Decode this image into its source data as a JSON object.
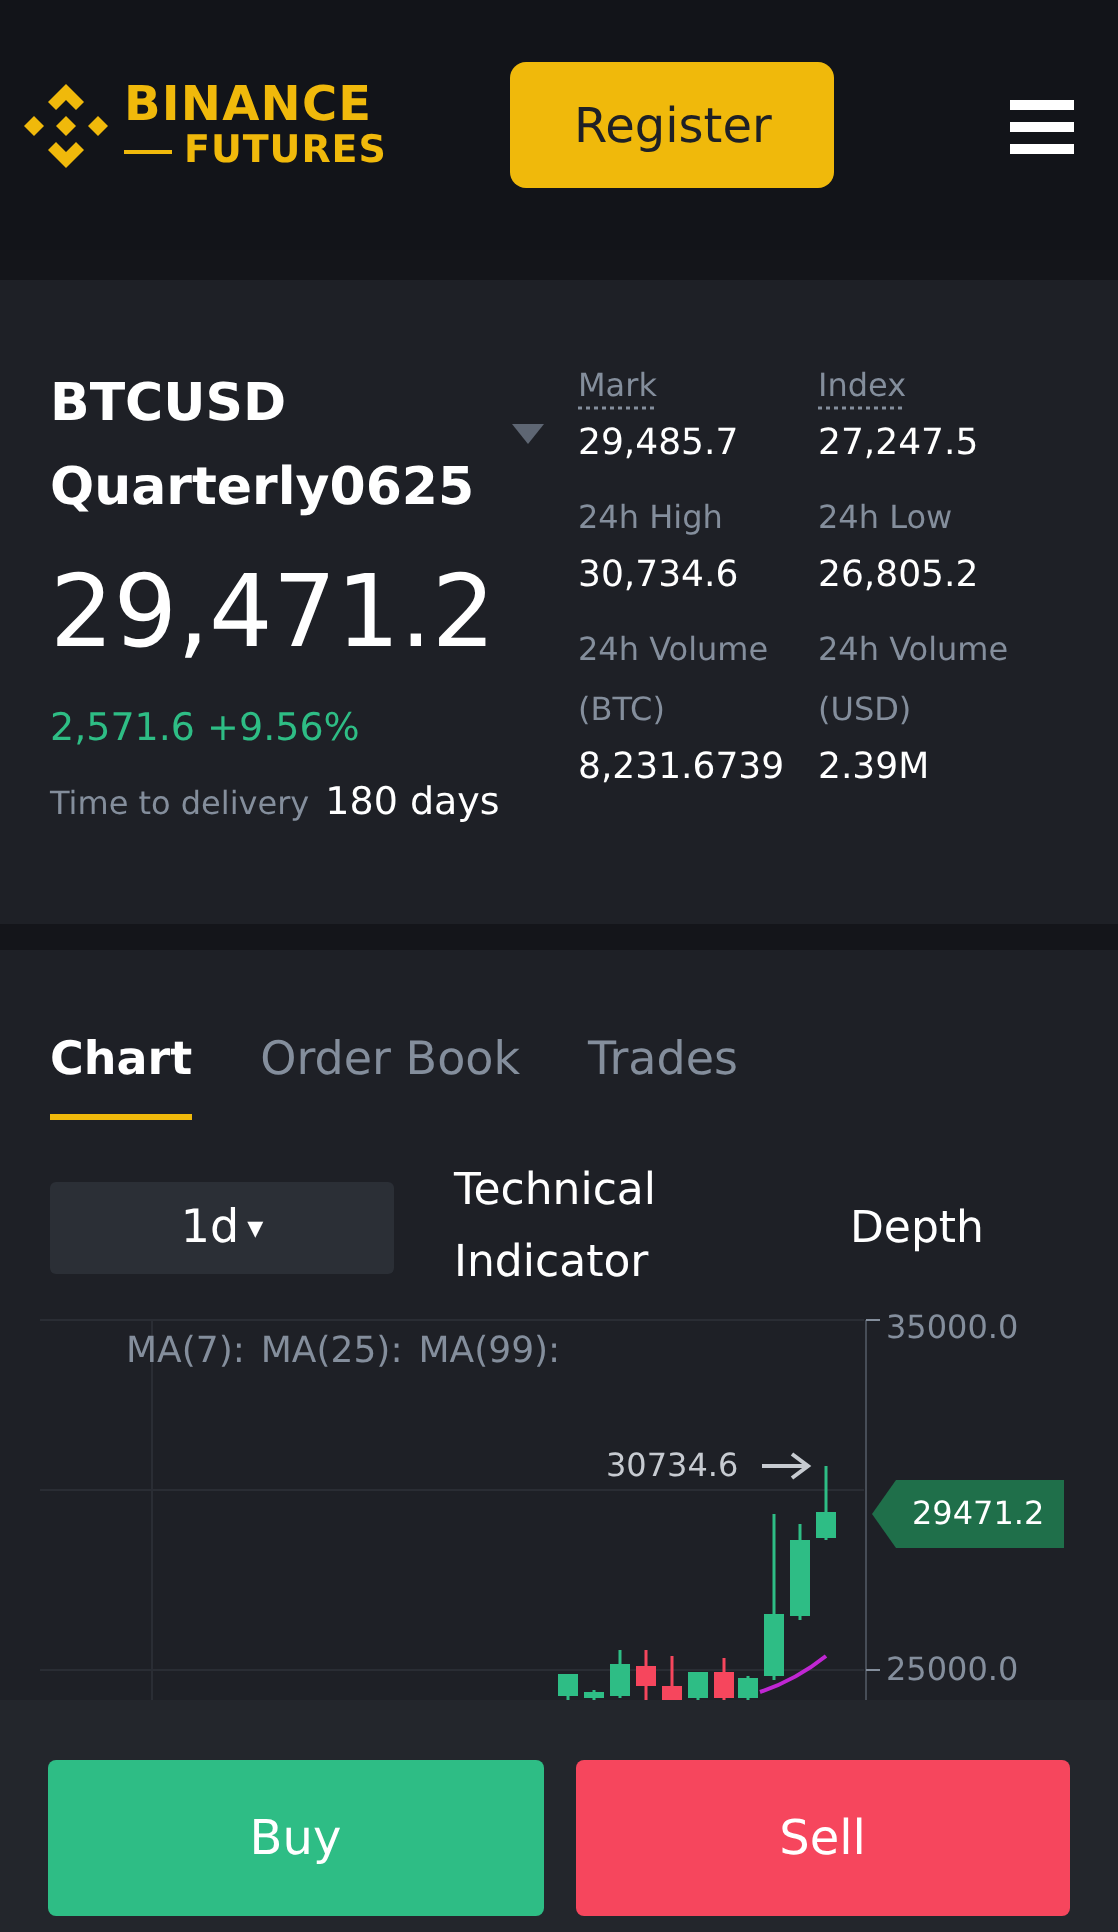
{
  "header": {
    "logo_top": "BINANCE",
    "logo_bottom": "FUTURES",
    "register": "Register"
  },
  "ticker": {
    "symbol": "BTCUSD",
    "contract": "Quarterly0625",
    "price": "29,471.2",
    "change": "2,571.6 +9.56%",
    "delivery_label": "Time to delivery",
    "delivery_value": "180 days",
    "stats": [
      {
        "label": "Mark",
        "value": "29,485.7",
        "underlined": true
      },
      {
        "label": "Index",
        "value": "27,247.5",
        "underlined": true
      },
      {
        "label": "24h High",
        "value": "30,734.6",
        "underlined": false
      },
      {
        "label": "24h Low",
        "value": "26,805.2",
        "underlined": false
      },
      {
        "label": "24h Volume (BTC)",
        "value": "8,231.6739",
        "underlined": false
      },
      {
        "label": "24h Volume (USD)",
        "value": "2.39M",
        "underlined": false
      }
    ]
  },
  "tabs": [
    {
      "label": "Chart",
      "selected": true
    },
    {
      "label": "Order Book",
      "selected": false
    },
    {
      "label": "Trades",
      "selected": false
    }
  ],
  "toolbar": {
    "interval": "1d",
    "caret": "▾",
    "indicator": "Technical Indicator",
    "depth": "Depth"
  },
  "chart": {
    "ma_labels": [
      "MA(7):",
      "MA(25):",
      "MA(99):"
    ],
    "high_marker": "30734.6",
    "price_tag": "29471.2",
    "axis_labels": [
      "35000.0",
      "25000.0"
    ]
  },
  "actions": [
    {
      "label": "Buy",
      "kind": "buy"
    },
    {
      "label": "Sell",
      "kind": "sell"
    }
  ]
}
